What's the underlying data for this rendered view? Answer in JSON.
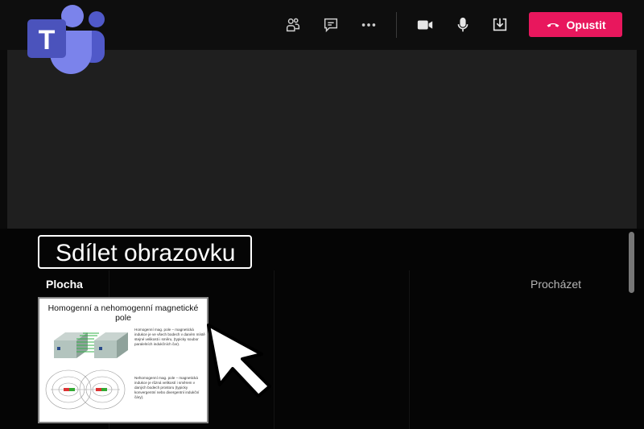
{
  "app": {
    "logo_letter": "T"
  },
  "topbar": {
    "icons": [
      "people-icon",
      "chat-icon",
      "more-icon",
      "camera-icon",
      "mic-icon",
      "share-tray-icon"
    ],
    "leave_label": "Opustit",
    "leave_color": "#e8175d"
  },
  "share_panel": {
    "title": "Sdílet obrazovku",
    "desktop_label": "Plocha",
    "browse_label": "Procházet",
    "thumbnail": {
      "slide_title": "Homogenní a nehomogenní magnetické pole",
      "text_top": "Homogenní mag. pole – magnetická indukce je ve všech bodech v daném místě stejné velikosti i směru, (typicky soubor paralelních indukčních čar).",
      "text_bottom": "Nehomogenní mag. pole – magnetická indukce je různá velikostí i směrem v daných bodech prostoru (typicky konvergentní nebo divergentní indukční čáry)."
    }
  }
}
